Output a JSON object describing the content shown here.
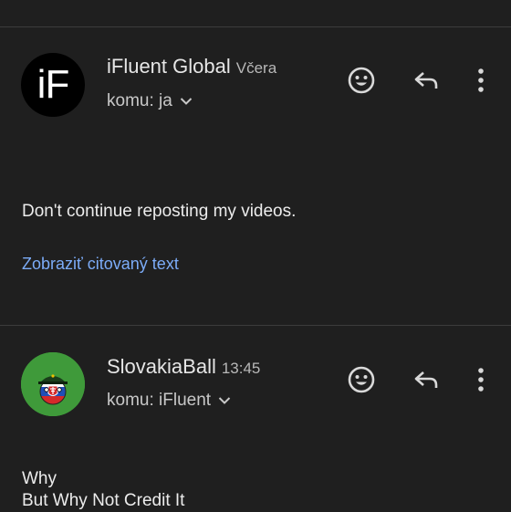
{
  "messages": [
    {
      "avatar_text": "iF",
      "sender": "iFluent Global",
      "time": "Včera",
      "recipient": "komu: ja",
      "body_lines": [
        "Don't continue reposting my videos."
      ],
      "show_quoted": "Zobraziť citovaný text"
    },
    {
      "avatar_text": "",
      "sender": "SlovakiaBall",
      "time": "13:45",
      "recipient": "komu: iFluent",
      "body_lines": [
        "Why",
        "But Why Not Credit It"
      ]
    }
  ],
  "icons": {
    "emoji": "emoji-reaction-icon",
    "reply": "reply-icon",
    "more": "more-vert-icon",
    "chevron": "chevron-down-icon"
  },
  "colors": {
    "background": "#1f1f1f",
    "link": "#7cacf8",
    "divider": "#3c3c3c",
    "avatar2_bg": "#3f9a3a"
  }
}
